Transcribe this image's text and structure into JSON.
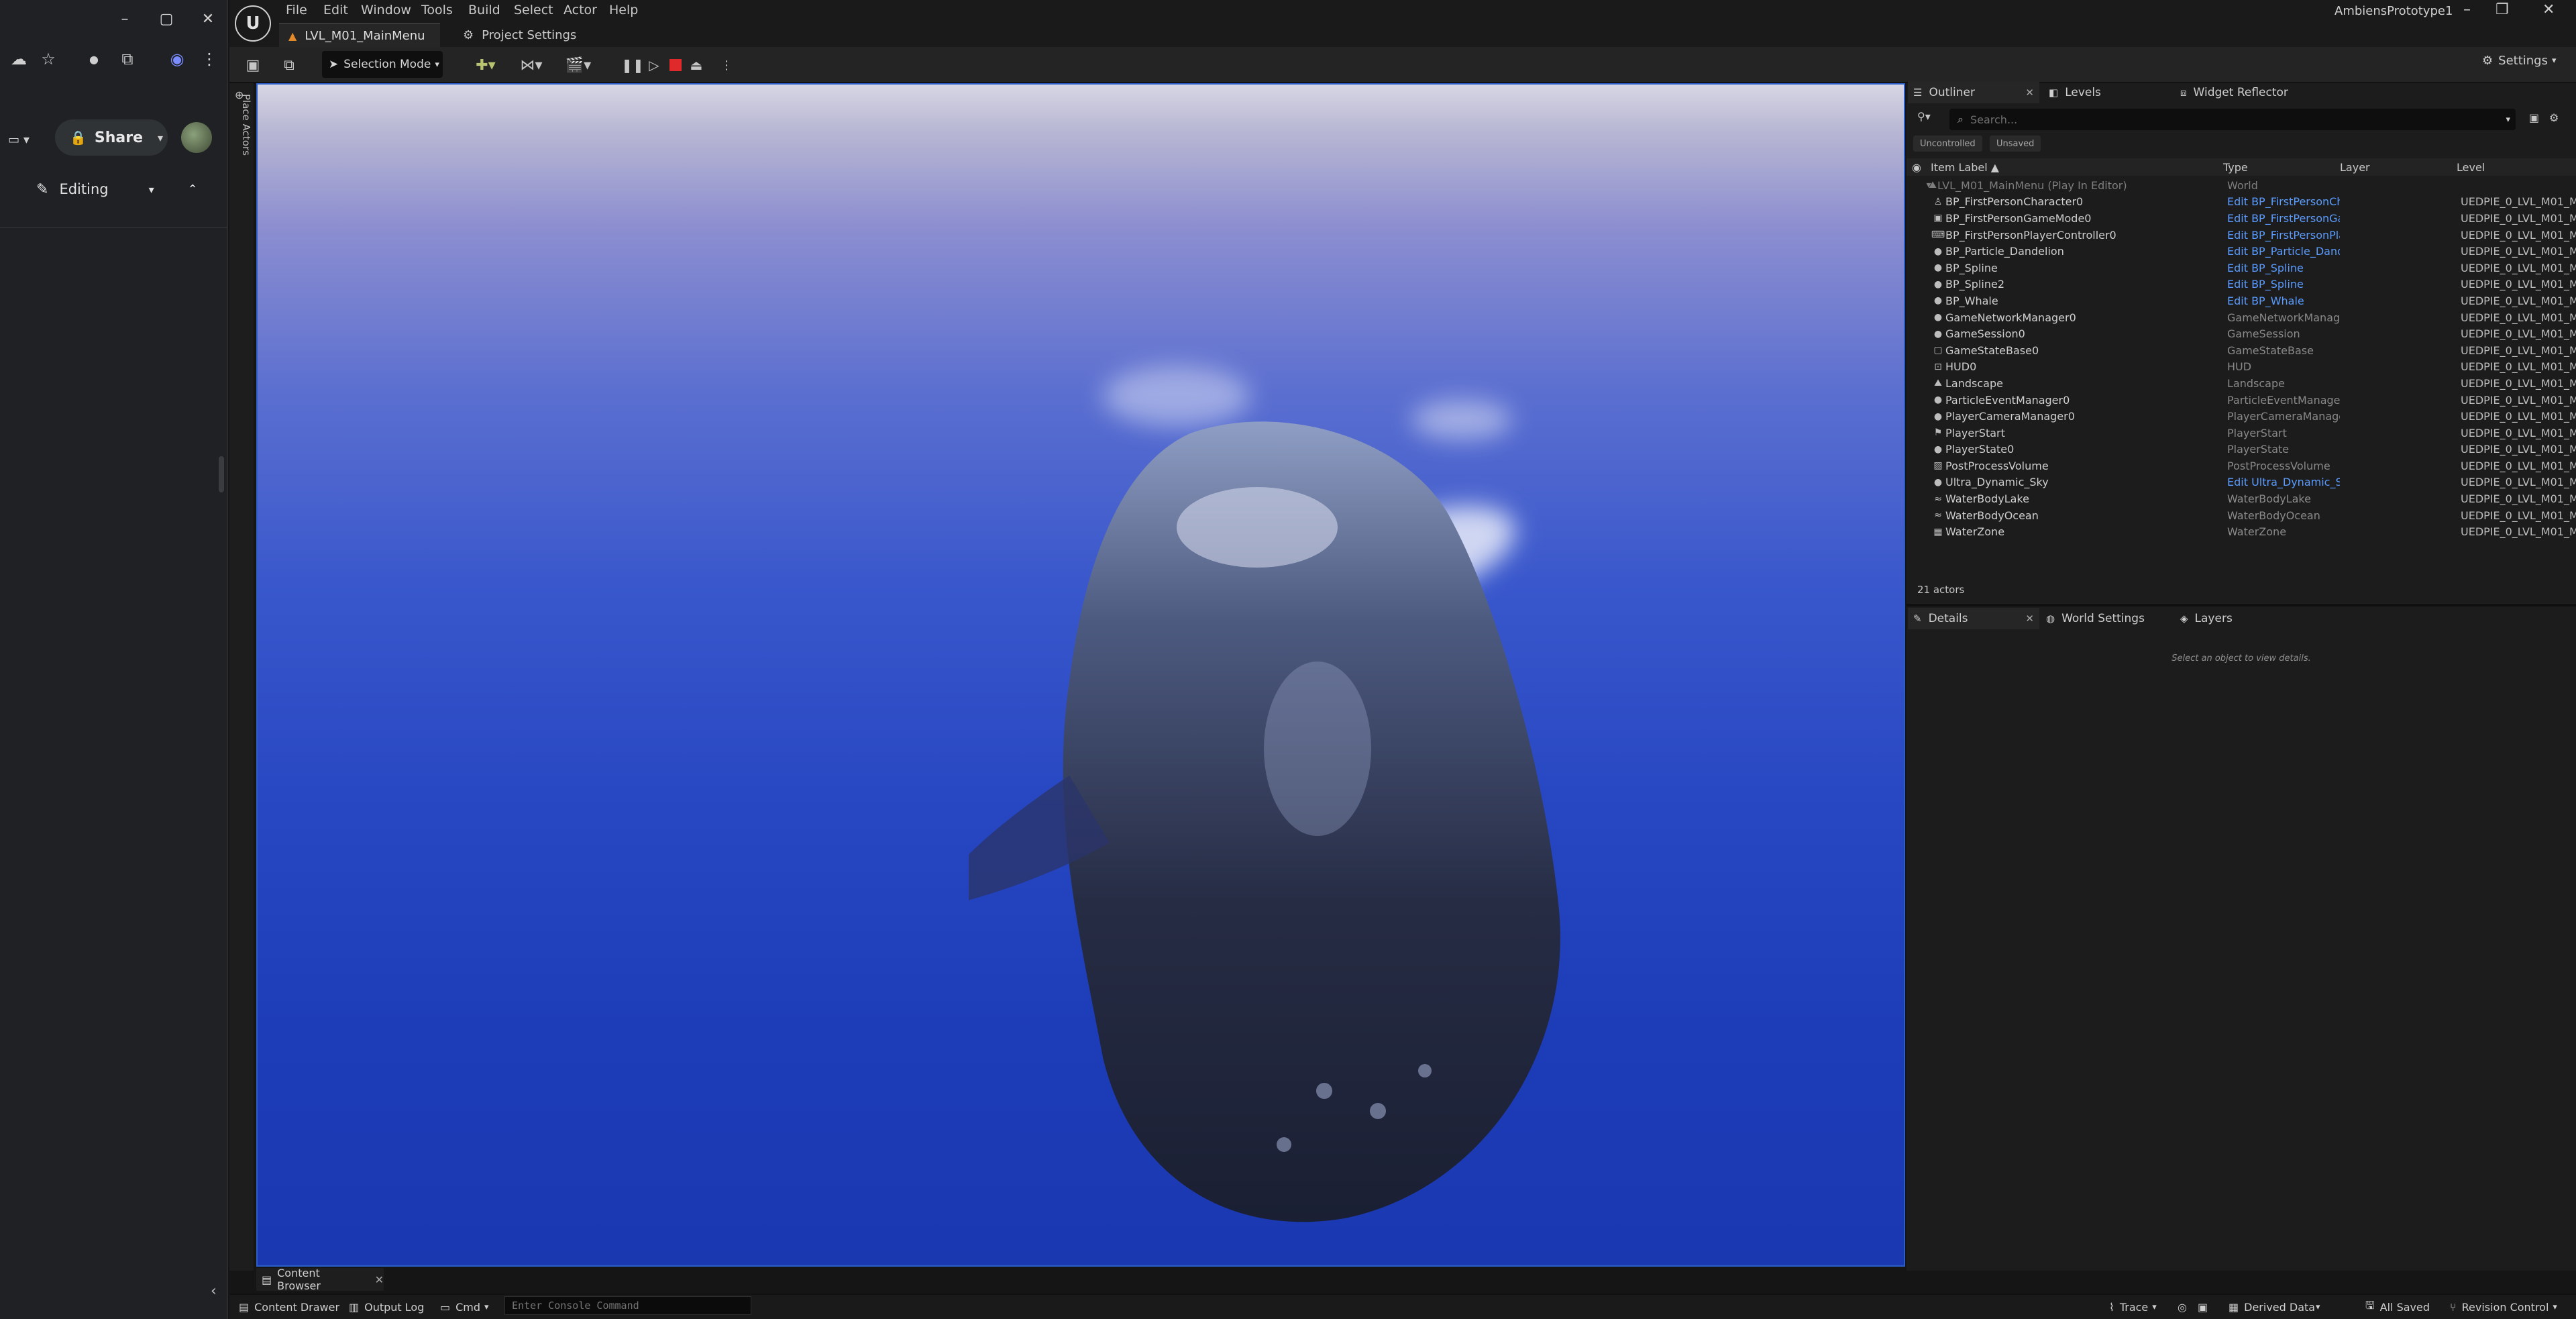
{
  "browser": {
    "share_label": "Share",
    "editing_label": "Editing"
  },
  "menu": [
    "File",
    "Edit",
    "Window",
    "Tools",
    "Build",
    "Select",
    "Actor",
    "Help"
  ],
  "tabs": {
    "level": "LVL_M01_MainMenu",
    "project_settings": "Project Settings"
  },
  "project_name": "AmbiensPrototype1",
  "toolbar": {
    "selection_mode": "Selection Mode",
    "settings": "Settings"
  },
  "place_actors_label": "Place Actors",
  "outliner": {
    "tabs": [
      "Outliner",
      "Levels",
      "Widget Reflector"
    ],
    "search_placeholder": "Search...",
    "chips": [
      "Uncontrolled",
      "Unsaved"
    ],
    "columns": {
      "label": "Item Label",
      "type": "Type",
      "layer": "Layer",
      "level": "Level"
    },
    "world_row": {
      "name": "LVL_M01_MainMenu (Play In Editor)",
      "type": "World"
    },
    "rows": [
      {
        "icon": "person-icon",
        "name": "BP_FirstPersonCharacter0",
        "type": "Edit BP_FirstPersonCh",
        "link": true,
        "level": "UEDPIE_0_LVL_M01_M"
      },
      {
        "icon": "gamemode-icon",
        "name": "BP_FirstPersonGameMode0",
        "type": "Edit BP_FirstPersonGa",
        "link": true,
        "level": "UEDPIE_0_LVL_M01_M"
      },
      {
        "icon": "controller-icon",
        "name": "BP_FirstPersonPlayerController0",
        "type": "Edit BP_FirstPersonPla",
        "link": true,
        "level": "UEDPIE_0_LVL_M01_M"
      },
      {
        "icon": "actor-icon",
        "name": "BP_Particle_Dandelion",
        "type": "Edit BP_Particle_Dande",
        "link": true,
        "level": "UEDPIE_0_LVL_M01_M"
      },
      {
        "icon": "actor-icon",
        "name": "BP_Spline",
        "type": "Edit BP_Spline",
        "link": true,
        "level": "UEDPIE_0_LVL_M01_M"
      },
      {
        "icon": "actor-icon",
        "name": "BP_Spline2",
        "type": "Edit BP_Spline",
        "link": true,
        "level": "UEDPIE_0_LVL_M01_M"
      },
      {
        "icon": "actor-icon",
        "name": "BP_Whale",
        "type": "Edit BP_Whale",
        "link": true,
        "level": "UEDPIE_0_LVL_M01_M"
      },
      {
        "icon": "actor-icon",
        "name": "GameNetworkManager0",
        "type": "GameNetworkManage",
        "link": false,
        "level": "UEDPIE_0_LVL_M01_M"
      },
      {
        "icon": "actor-icon",
        "name": "GameSession0",
        "type": "GameSession",
        "link": false,
        "level": "UEDPIE_0_LVL_M01_M"
      },
      {
        "icon": "gamestate-icon",
        "name": "GameStateBase0",
        "type": "GameStateBase",
        "link": false,
        "level": "UEDPIE_0_LVL_M01_M"
      },
      {
        "icon": "hud-icon",
        "name": "HUD0",
        "type": "HUD",
        "link": false,
        "level": "UEDPIE_0_LVL_M01_M"
      },
      {
        "icon": "landscape-icon",
        "name": "Landscape",
        "type": "Landscape",
        "link": false,
        "level": "UEDPIE_0_LVL_M01_M"
      },
      {
        "icon": "actor-icon",
        "name": "ParticleEventManager0",
        "type": "ParticleEventManager",
        "link": false,
        "level": "UEDPIE_0_LVL_M01_M"
      },
      {
        "icon": "actor-icon",
        "name": "PlayerCameraManager0",
        "type": "PlayerCameraManage",
        "link": false,
        "level": "UEDPIE_0_LVL_M01_M"
      },
      {
        "icon": "playerstart-icon",
        "name": "PlayerStart",
        "type": "PlayerStart",
        "link": false,
        "level": "UEDPIE_0_LVL_M01_M"
      },
      {
        "icon": "actor-icon",
        "name": "PlayerState0",
        "type": "PlayerState",
        "link": false,
        "level": "UEDPIE_0_LVL_M01_M"
      },
      {
        "icon": "postprocess-icon",
        "name": "PostProcessVolume",
        "type": "PostProcessVolume",
        "link": false,
        "level": "UEDPIE_0_LVL_M01_M"
      },
      {
        "icon": "actor-icon",
        "name": "Ultra_Dynamic_Sky",
        "type": "Edit Ultra_Dynamic_Sk",
        "link": true,
        "level": "UEDPIE_0_LVL_M01_M"
      },
      {
        "icon": "water-icon",
        "name": "WaterBodyLake",
        "type": "WaterBodyLake",
        "link": false,
        "level": "UEDPIE_0_LVL_M01_M"
      },
      {
        "icon": "water-icon",
        "name": "WaterBodyOcean",
        "type": "WaterBodyOcean",
        "link": false,
        "level": "UEDPIE_0_LVL_M01_M"
      },
      {
        "icon": "waterzone-icon",
        "name": "WaterZone",
        "type": "WaterZone",
        "link": false,
        "level": "UEDPIE_0_LVL_M01_M"
      }
    ],
    "actor_count": "21 actors"
  },
  "details": {
    "tabs": [
      "Details",
      "World Settings",
      "Layers"
    ],
    "empty_text": "Select an object to view details."
  },
  "content_browser_tab": "Content Browser",
  "statusbar": {
    "content_drawer": "Content Drawer",
    "output_log": "Output Log",
    "cmd": "Cmd",
    "console_placeholder": "Enter Console Command",
    "trace": "Trace",
    "derived_data": "Derived Data",
    "all_saved": "All Saved",
    "revision_control": "Revision Control"
  },
  "colors": {
    "link": "#5a9cff",
    "viewport_border": "#2c5ec8",
    "stop_red": "#e0292b",
    "level_tab_icon": "#e38b2a"
  }
}
